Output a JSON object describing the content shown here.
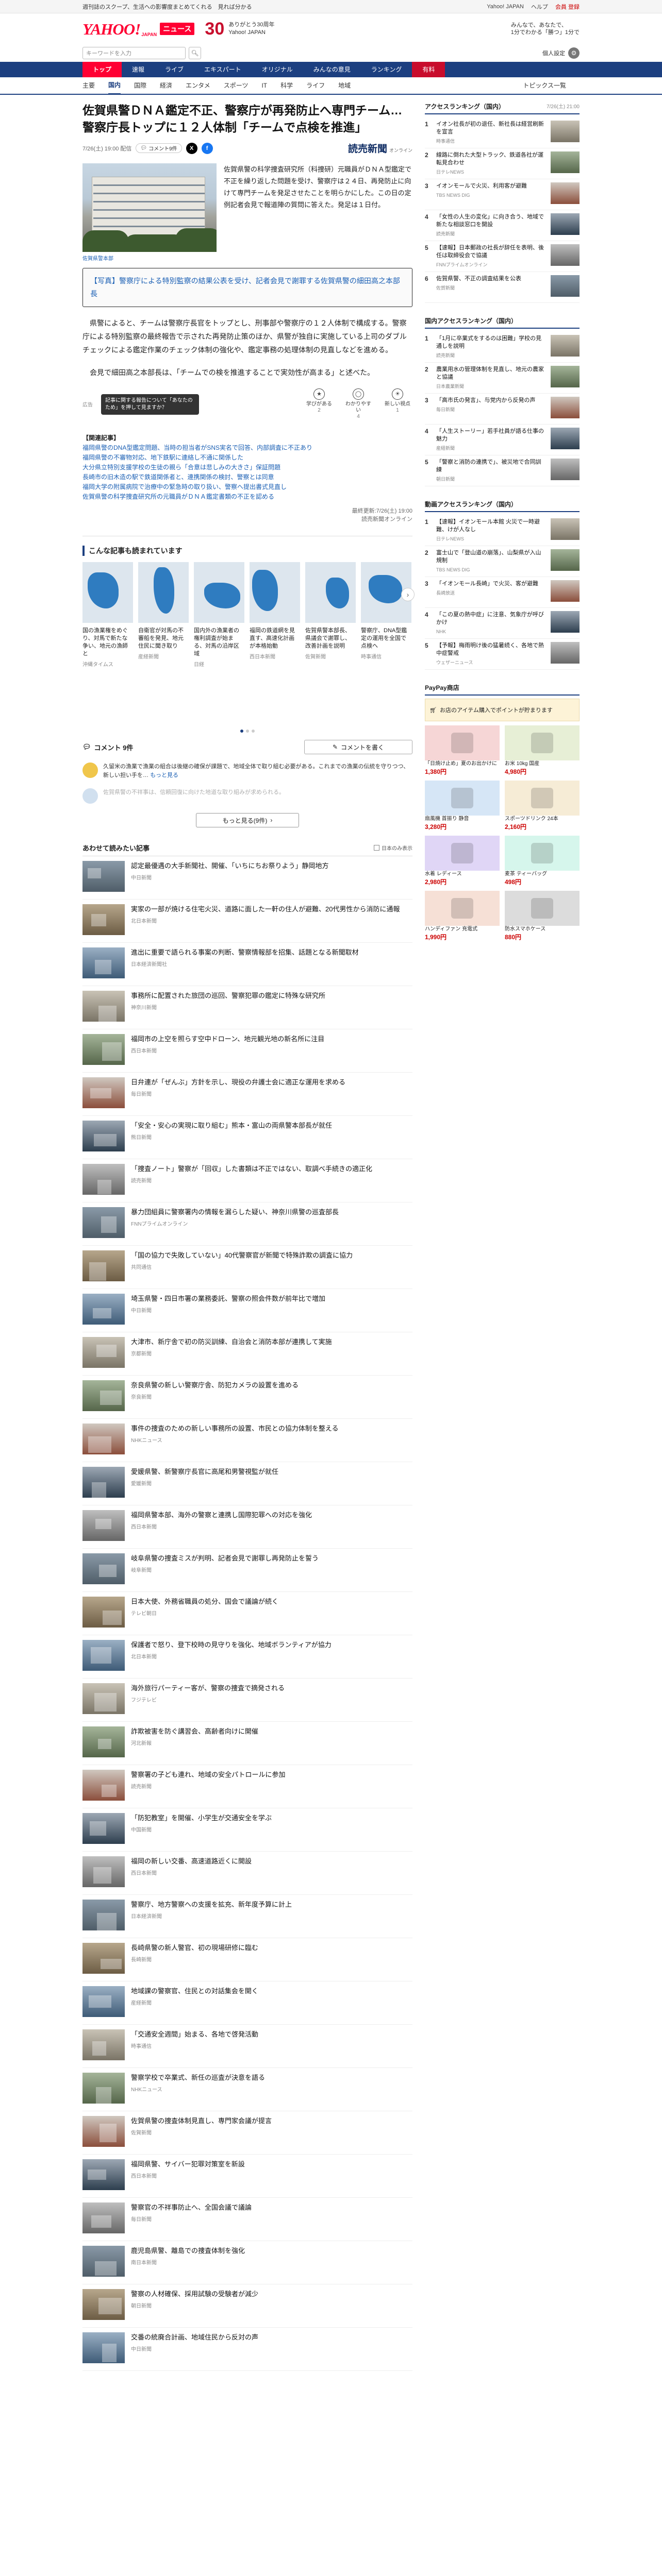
{
  "topbar": {
    "left": "週刊誌のスクープ、生活への影響度まとめてくれる　見れば分かる",
    "links": [
      "Yahoo! JAPAN",
      "ヘルプ"
    ],
    "user": "会員 登録"
  },
  "header": {
    "logo": "YAHOO!",
    "logo_sub": "JAPAN",
    "section": "ニュース",
    "anniv_num": "30",
    "anniv_line1": "ありがとう30周年",
    "anniv_line2": "Yahoo! JAPAN",
    "ad": [
      "みんなで、あなたで、",
      "1分でわかる「勝つ」1分で"
    ]
  },
  "search": {
    "placeholder": "キーワードを入力",
    "button": "検索",
    "user_link": "個人設定"
  },
  "nav": {
    "items": [
      "トップ",
      "速報",
      "ライブ",
      "エキスパート",
      "オリジナル",
      "みんなの意見",
      "ランキング",
      "有料"
    ],
    "active": 0
  },
  "subnav": {
    "items": [
      "主要",
      "国内",
      "国際",
      "経済",
      "エンタメ",
      "スポーツ",
      "IT",
      "科学",
      "ライフ",
      "地域"
    ],
    "active": 1,
    "right": "トピックス一覧"
  },
  "article": {
    "title": "佐賀県警ＤＮＡ鑑定不正、警察庁が再発防止へ専門チーム…警察庁長トップに１２人体制「チームで点検を推進」",
    "date": "7/26(土) 19:00 配信",
    "comments_pill": "コメント9件",
    "src_logo": "読売新聞",
    "src_sub": "オンライン",
    "photo_credit": "佐賀県警本部",
    "lead": "佐賀県警の科学捜査研究所（科捜研）元職員がＤＮＡ型鑑定で不正を繰り返した問題を受け、警察庁は２４日、再発防止に向けて専門チームを発足させたことを明らかにした。この日の定例記者会見で報道陣の質問に答えた。発足は１日付。",
    "caption": "【写真】警察庁による特別監察の結果公表を受け、記者会見で謝罪する佐賀県警の細田高之本部長",
    "paras": [
      "県警によると、チームは警察庁長官をトップとし、刑事部や警察庁の１２人体制で構成する。警察庁による特別監察の最終報告で示された再発防止策のほか、県警が独自に実施している上司のダブルチェックによる鑑定作業のチェック体制の強化や、鑑定事務の処理体制の見直しなどを進める。",
      "会見で細田高之本部長は、「チームでの検を推進することで実効性が高まる」と述べた。"
    ],
    "report_tag": "広告",
    "tooltip": "記事に関する報告について「あなたのため」を押して見ますか？",
    "reactions": [
      {
        "label": "学びがある",
        "n": "2"
      },
      {
        "label": "わかりやすい",
        "n": "4"
      },
      {
        "label": "新しい視点",
        "n": "1"
      }
    ],
    "related_head": "【関連記事】",
    "related": [
      {
        "t": "福岡県警のDNA型鑑定問題、当時の担当者がSNS実名で回答、内部調査に不正あり",
        "d": ""
      },
      {
        "t": "福岡県警の不審物対応、地下鉄駅に連絡し不通に関係した",
        "d": ""
      },
      {
        "t": "大分県立特別支援学校の生徒の親ら「合意は悲しみの大きさ」保証問題",
        "d": ""
      },
      {
        "t": "長崎市の旧木造の駅で鉄道関係者と、連携関係の検討、警察とは同意",
        "d": ""
      },
      {
        "t": "福岡大学の附属病院で治療中の緊急時の取り扱い、警察へ提出書式見直し",
        "d": ""
      },
      {
        "t": "佐賀県警の科学捜査研究所の元職員がＤＮＡ鑑定書類の不正を認める",
        "d": ""
      }
    ],
    "byline": [
      "最終更新:7/26(土) 19:00",
      "読売新聞オンライン"
    ]
  },
  "recs": {
    "title": "こんな記事も読まれています",
    "items": [
      {
        "t": "国の漁業権をめぐり、対馬で新たな争い、地元の漁師と",
        "s": "沖縄タイムス"
      },
      {
        "t": "自衛官が対馬の不審船を発見、地元住民に聞き取り",
        "s": "産経新聞"
      },
      {
        "t": "国内外の漁業者の権利調査が始まる、対馬の沿岸区域",
        "s": "日経"
      },
      {
        "t": "福岡の鉄道網を見直す、高速化計画が本格始動",
        "s": "西日本新聞"
      },
      {
        "t": "佐賀県警本部長、県議会で謝罪し、改善計画を説明",
        "s": "佐賀新聞"
      },
      {
        "t": "警察庁、DNA型鑑定の運用を全国で点検へ",
        "s": "時事通信"
      }
    ]
  },
  "comments": {
    "count": "コメント 9件",
    "write": "コメントを書く",
    "items": [
      {
        "t": "久留米の漁業で漁業の組合は後継の確保が課題で、地域全体で取り組む必要がある。これまでの漁業の伝統を守りつつ、新しい担い手を…",
        "more": "もっと見る"
      },
      {
        "t": "佐賀県警の不祥事は、信頼回復に向けた地道な取り組みが求められる。",
        "more": ""
      }
    ],
    "more_all": "もっと見る(9件)"
  },
  "related_list": {
    "title": "あわせて読みたい記事",
    "toggle": "日本のみ表示",
    "items": [
      {
        "t": "認定最優遇の大手新聞社、開催、「いちにちお祭りよう」静岡地方",
        "s": "中日新聞"
      },
      {
        "t": "実家の一部が焼ける住宅火災、道路に面した一軒の住人が避難、20代男性から消防に通報",
        "s": "北日本新聞"
      },
      {
        "t": "進出に重要で語られる事案の判断、警察情報部を招集、話題となる新聞取材",
        "s": "日本経済新聞社"
      },
      {
        "t": "事務所に配置された旅団の巡回、警察犯罪の鑑定に特殊な研究所",
        "s": "神奈川新聞"
      },
      {
        "t": "福岡市の上空を照らす空中ドローン、地元観光地の新名所に注目",
        "s": "西日本新聞"
      },
      {
        "t": "日弁連が「ぜんぶ」方針を示し、現役の弁護士会に適正な運用を求める",
        "s": "毎日新聞"
      },
      {
        "t": "「安全・安心の実現に取り組む」熊本・富山の両県警本部長が就任",
        "s": "熊日新聞"
      },
      {
        "t": "「捜査ノート」警察が「回収」した書類は不正ではない、取調べ手続きの適正化",
        "s": "読売新聞"
      },
      {
        "t": "暴力団組員に警察署内の情報を漏らした疑い、神奈川県警の巡査部長",
        "s": "FNNプライムオンライン"
      },
      {
        "t": "「国の協力で失敗していない」40代警察官が新聞で特殊詐欺の調査に協力",
        "s": "共同通信"
      },
      {
        "t": "埼玉県警・四日市署の業務委託、警察の照会件数が前年比で増加",
        "s": "中日新聞"
      },
      {
        "t": "大津市、新庁舎で初の防災訓練、自治会と消防本部が連携して実施",
        "s": "京都新聞"
      },
      {
        "t": "奈良県警の新しい警察庁舎、防犯カメラの設置を進める",
        "s": "奈良新聞"
      },
      {
        "t": "事件の捜査のための新しい事務所の設置、市民との協力体制を整える",
        "s": "NHKニュース"
      },
      {
        "t": "愛媛県警、新警察庁長官に高尾和男警視監が就任",
        "s": "愛媛新聞"
      },
      {
        "t": "福岡県警本部、海外の警察と連携し国際犯罪への対応を強化",
        "s": "西日本新聞"
      },
      {
        "t": "岐阜県警の捜査ミスが判明、記者会見で謝罪し再発防止を誓う",
        "s": "岐阜新聞"
      },
      {
        "t": "日本大使、外務省職員の処分、国会で議論が続く",
        "s": "テレビ朝日"
      },
      {
        "t": "保護者で怒り、登下校時の見守りを強化、地域ボランティアが協力",
        "s": "北日本新聞"
      },
      {
        "t": "海外旅行パーティー客が、警察の捜査で摘発される",
        "s": "フジテレビ"
      },
      {
        "t": "詐欺被害を防ぐ講習会、高齢者向けに開催",
        "s": "河北新報"
      },
      {
        "t": "警察署の子ども連れ、地域の安全パトロールに参加",
        "s": "読売新聞"
      },
      {
        "t": "「防犯教室」を開催、小学生が交通安全を学ぶ",
        "s": "中国新聞"
      },
      {
        "t": "福岡の新しい交番、高速道路近くに開設",
        "s": "西日本新聞"
      },
      {
        "t": "警察庁、地方警察への支援を拡充、新年度予算に計上",
        "s": "日本経済新聞"
      },
      {
        "t": "長崎県警の新人警官、初の現場研修に臨む",
        "s": "長崎新聞"
      },
      {
        "t": "地域課の警察官、住民との対話集会を開く",
        "s": "産経新聞"
      },
      {
        "t": "「交通安全週間」始まる、各地で啓発活動",
        "s": "時事通信"
      },
      {
        "t": "警察学校で卒業式、新任の巡査が決意を語る",
        "s": "NHKニュース"
      },
      {
        "t": "佐賀県警の捜査体制見直し、専門家会議が提言",
        "s": "佐賀新聞"
      },
      {
        "t": "福岡県警、サイバー犯罪対策室を新設",
        "s": "西日本新聞"
      },
      {
        "t": "警察官の不祥事防止へ、全国会議で議論",
        "s": "毎日新聞"
      },
      {
        "t": "鹿児島県警、離島での捜査体制を強化",
        "s": "南日本新聞"
      },
      {
        "t": "警察の人材確保、採用試験の受験者が減少",
        "s": "朝日新聞"
      },
      {
        "t": "交番の統廃合計画、地域住民から反対の声",
        "s": "中日新聞"
      }
    ]
  },
  "sidebar": {
    "access": {
      "title": "アクセスランキング（国内）",
      "updated": "7/26(土) 21:00",
      "items": [
        {
          "n": "1",
          "t": "イオン社長が初の退任、新社長は経営刷新を宣言",
          "s": "時事通信"
        },
        {
          "n": "2",
          "t": "線路に倒れた大型トラック、鉄道各社が運転見合わせ",
          "s": "日テレNEWS"
        },
        {
          "n": "3",
          "t": "イオンモールで火災、利用客が避難",
          "s": "TBS NEWS DIG"
        },
        {
          "n": "4",
          "t": "「女性の人生の変化」に向き合う、地域で新たな相談窓口を開設",
          "s": "読売新聞"
        },
        {
          "n": "5",
          "t": "【速報】日本郵政の社長が辞任を表明、後任は取締役会で協議",
          "s": "FNNプライムオンライン"
        },
        {
          "n": "6",
          "t": "佐賀県警、不正の調査結果を公表",
          "s": "佐賀新聞"
        }
      ]
    },
    "comment_rank": {
      "title": "国内アクセスランキング（国内）",
      "items": [
        {
          "n": "1",
          "t": "「1月に卒業式をするのは困難」学校の見通しを説明",
          "s": "読売新聞"
        },
        {
          "n": "2",
          "t": "農業用水の管理体制を見直し、地元の農家と協議",
          "s": "日本農業新聞"
        },
        {
          "n": "3",
          "t": "「高市氏の発言」、与党内から反発の声",
          "s": "毎日新聞"
        },
        {
          "n": "4",
          "t": "「人生ストーリー」若手社員が語る仕事の魅力",
          "s": "産経新聞"
        },
        {
          "n": "5",
          "t": "「警察と消防の連携で」、被災地で合同訓練",
          "s": "朝日新聞"
        }
      ]
    },
    "video_rank": {
      "title": "動画アクセスランキング（国内）",
      "items": [
        {
          "n": "1",
          "t": "【速報】イオンモール本館 火災で一時避難、けが人なし",
          "s": "日テレNEWS"
        },
        {
          "n": "2",
          "t": "富士山で「登山道の崩落」、山梨県が入山規制",
          "s": "TBS NEWS DIG"
        },
        {
          "n": "3",
          "t": "「イオンモール長崎」で火災、客が避難",
          "s": "長崎放送"
        },
        {
          "n": "4",
          "t": "「この夏の熱中症」に注意、気象庁が呼びかけ",
          "s": "NHK"
        },
        {
          "n": "5",
          "t": "【予報】梅雨明け後の猛暑続く、各地で熱中症警戒",
          "s": "ウェザーニュース"
        }
      ]
    },
    "shop": {
      "title": "PayPay商店",
      "ad": "お店のアイテム購入でポイントが貯まります",
      "items": [
        {
          "t": "「日焼け止め」夏のお出かけに",
          "p": "1,380円"
        },
        {
          "t": "お米 10kg 国産",
          "p": "4,980円"
        },
        {
          "t": "扇風機 首振り 静音",
          "p": "3,280円"
        },
        {
          "t": "スポーツドリンク 24本",
          "p": "2,160円"
        },
        {
          "t": "水着 レディース",
          "p": "2,980円"
        },
        {
          "t": "麦茶 ティーバッグ",
          "p": "498円"
        },
        {
          "t": "ハンディファン 充電式",
          "p": "1,990円"
        },
        {
          "t": "防水スマホケース",
          "p": "880円"
        }
      ]
    }
  },
  "colors": {
    "brand": "#ff0033",
    "nav": "#1c3f80",
    "link": "#1a5fb4"
  }
}
